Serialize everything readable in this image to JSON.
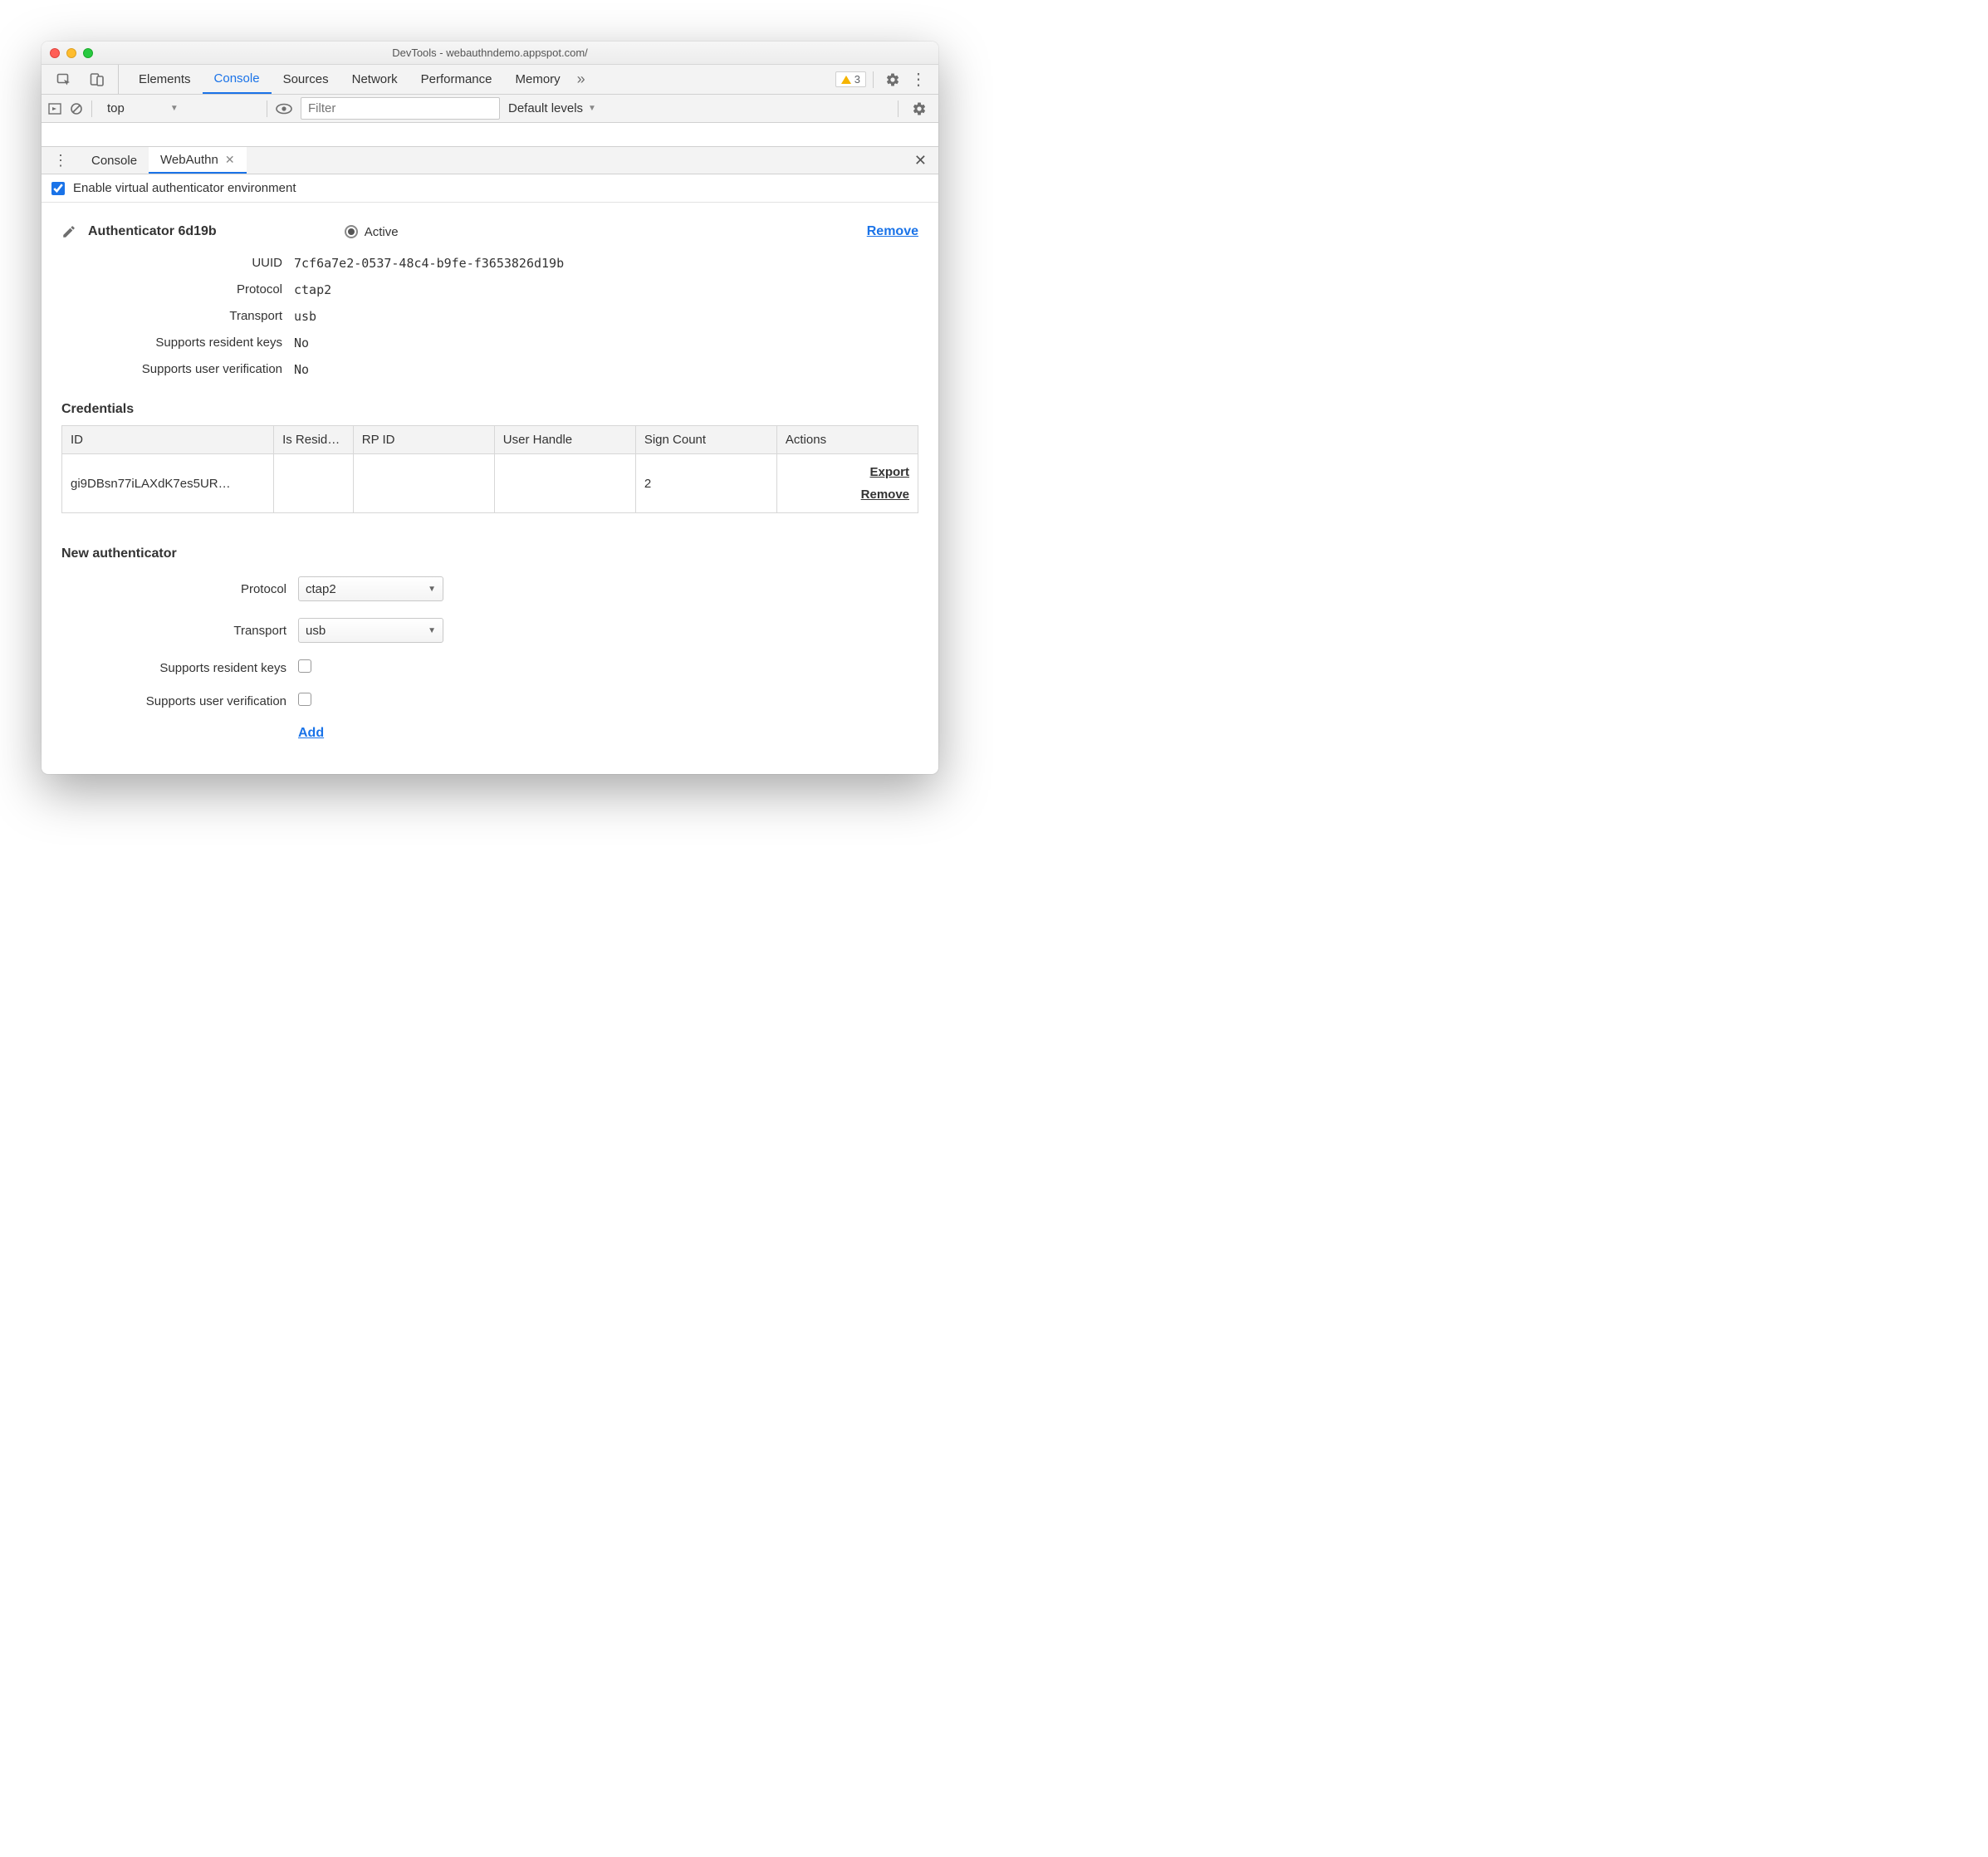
{
  "window": {
    "title": "DevTools - webauthndemo.appspot.com/"
  },
  "main_tabs": {
    "items": [
      "Elements",
      "Console",
      "Sources",
      "Network",
      "Performance",
      "Memory"
    ],
    "active": "Console",
    "warning_count": "3"
  },
  "console_bar": {
    "context": "top",
    "filter_placeholder": "Filter",
    "levels_label": "Default levels"
  },
  "drawer": {
    "tabs": {
      "console": "Console",
      "webauthn": "WebAuthn"
    },
    "active": "WebAuthn"
  },
  "enable": {
    "label": "Enable virtual authenticator environment",
    "checked": true
  },
  "authenticator": {
    "title": "Authenticator 6d19b",
    "active_label": "Active",
    "remove_label": "Remove",
    "fields": {
      "uuid_label": "UUID",
      "uuid": "7cf6a7e2-0537-48c4-b9fe-f3653826d19b",
      "protocol_label": "Protocol",
      "protocol": "ctap2",
      "transport_label": "Transport",
      "transport": "usb",
      "srk_label": "Supports resident keys",
      "srk": "No",
      "suv_label": "Supports user verification",
      "suv": "No"
    }
  },
  "credentials": {
    "title": "Credentials",
    "headers": {
      "id": "ID",
      "resident": "Is Resid…",
      "rpid": "RP ID",
      "user": "User Handle",
      "sign": "Sign Count",
      "actions": "Actions"
    },
    "row": {
      "id": "gi9DBsn77iLAXdK7es5UR…",
      "resident": "",
      "rpid": "",
      "user": "",
      "sign": "2"
    },
    "actions": {
      "export": "Export",
      "remove": "Remove"
    }
  },
  "new_auth": {
    "title": "New authenticator",
    "protocol_label": "Protocol",
    "protocol_value": "ctap2",
    "transport_label": "Transport",
    "transport_value": "usb",
    "srk_label": "Supports resident keys",
    "suv_label": "Supports user verification",
    "add_label": "Add"
  }
}
